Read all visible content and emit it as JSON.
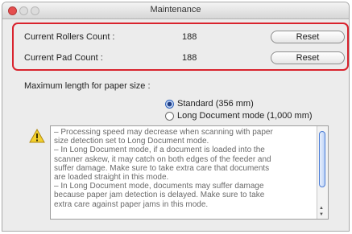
{
  "window": {
    "title": "Maintenance"
  },
  "counters": {
    "rollers": {
      "label": "Current Rollers Count :",
      "value": "188",
      "reset_label": "Reset"
    },
    "pad": {
      "label": "Current Pad Count :",
      "value": "188",
      "reset_label": "Reset"
    }
  },
  "paper_size": {
    "label": "Maximum length for paper size :",
    "options": [
      {
        "label": "Standard (356 mm)",
        "selected": true
      },
      {
        "label": "Long Document mode (1,000 mm)",
        "selected": false
      }
    ]
  },
  "warning": {
    "icon": "warning-icon",
    "lines": [
      "– Processing speed may decrease when scanning with paper",
      "size detection set to Long Document mode.",
      "– In Long Document mode, if a document is loaded into the",
      "scanner askew, it may catch on both edges of the feeder and",
      "suffer damage. Make sure to take extra care that documents",
      "are loaded straight in this mode.",
      "– In Long Document mode, documents may suffer damage",
      "because paper jam detection is delayed. Make sure to take",
      "extra care against paper jams in this mode."
    ]
  },
  "colors": {
    "highlight": "#d9232d",
    "close_button": "#e54e4e",
    "warning_icon": "#f3d02c"
  }
}
